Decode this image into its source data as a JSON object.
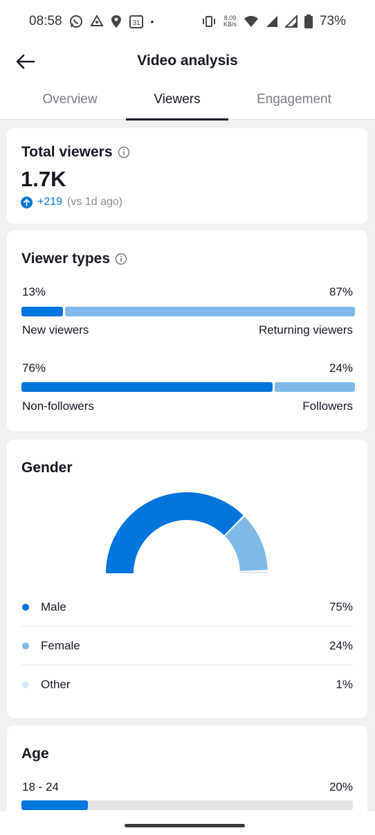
{
  "status_bar": {
    "time": "08:58",
    "calendar_day": "31",
    "dot": "•",
    "net_speed_value": "8.09",
    "net_speed_unit": "KB/s",
    "battery": "73%"
  },
  "header": {
    "title": "Video analysis"
  },
  "tabs": [
    {
      "label": "Overview",
      "active": false
    },
    {
      "label": "Viewers",
      "active": true
    },
    {
      "label": "Engagement",
      "active": false
    }
  ],
  "total_viewers": {
    "title": "Total viewers",
    "value": "1.7K",
    "delta": "+219",
    "delta_note": "(vs 1d ago)"
  },
  "viewer_types": {
    "title": "Viewer types",
    "split1": {
      "left_pct": "13%",
      "right_pct": "87%",
      "left_label": "New viewers",
      "right_label": "Returning viewers",
      "left_fraction": 0.13
    },
    "split2": {
      "left_pct": "76%",
      "right_pct": "24%",
      "left_label": "Non-followers",
      "right_label": "Followers",
      "left_fraction": 0.76
    }
  },
  "gender": {
    "title": "Gender",
    "items": [
      {
        "label": "Male",
        "value": "75%",
        "share": 0.75,
        "color": "#0075db"
      },
      {
        "label": "Female",
        "value": "24%",
        "share": 0.24,
        "color": "#7fb9ea"
      },
      {
        "label": "Other",
        "value": "1%",
        "share": 0.01,
        "color": "#d6e8f8"
      }
    ]
  },
  "age": {
    "title": "Age",
    "rows": [
      {
        "label": "18 - 24",
        "value": "20%",
        "fraction": 0.2
      }
    ]
  },
  "colors": {
    "accent": "#0075db",
    "accent_light": "#7fb9ea",
    "background": "#f1f1f2"
  }
}
